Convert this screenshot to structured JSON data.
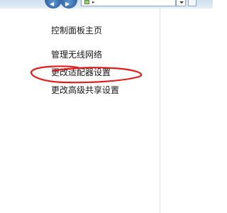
{
  "window": {
    "nav_back_glyph": "◀",
    "nav_forward_glyph": "▶",
    "address_separator": "▸"
  },
  "sidebar": {
    "items": [
      {
        "label": "控制面板主页",
        "icon": "none"
      },
      {
        "label": "管理无线网络",
        "icon": "none"
      },
      {
        "label": "更改适配器设置",
        "icon": "none",
        "highlighted_by_annotation": true
      },
      {
        "label": "更改高级共享设置",
        "icon": "none"
      }
    ]
  },
  "annotation": {
    "type": "hand-drawn-ellipse",
    "color": "#e02020",
    "target": "更改适配器设置"
  },
  "colors": {
    "link_text": "#1a1a1a",
    "background": "#ffffff",
    "chrome": "#d6e4f2"
  }
}
